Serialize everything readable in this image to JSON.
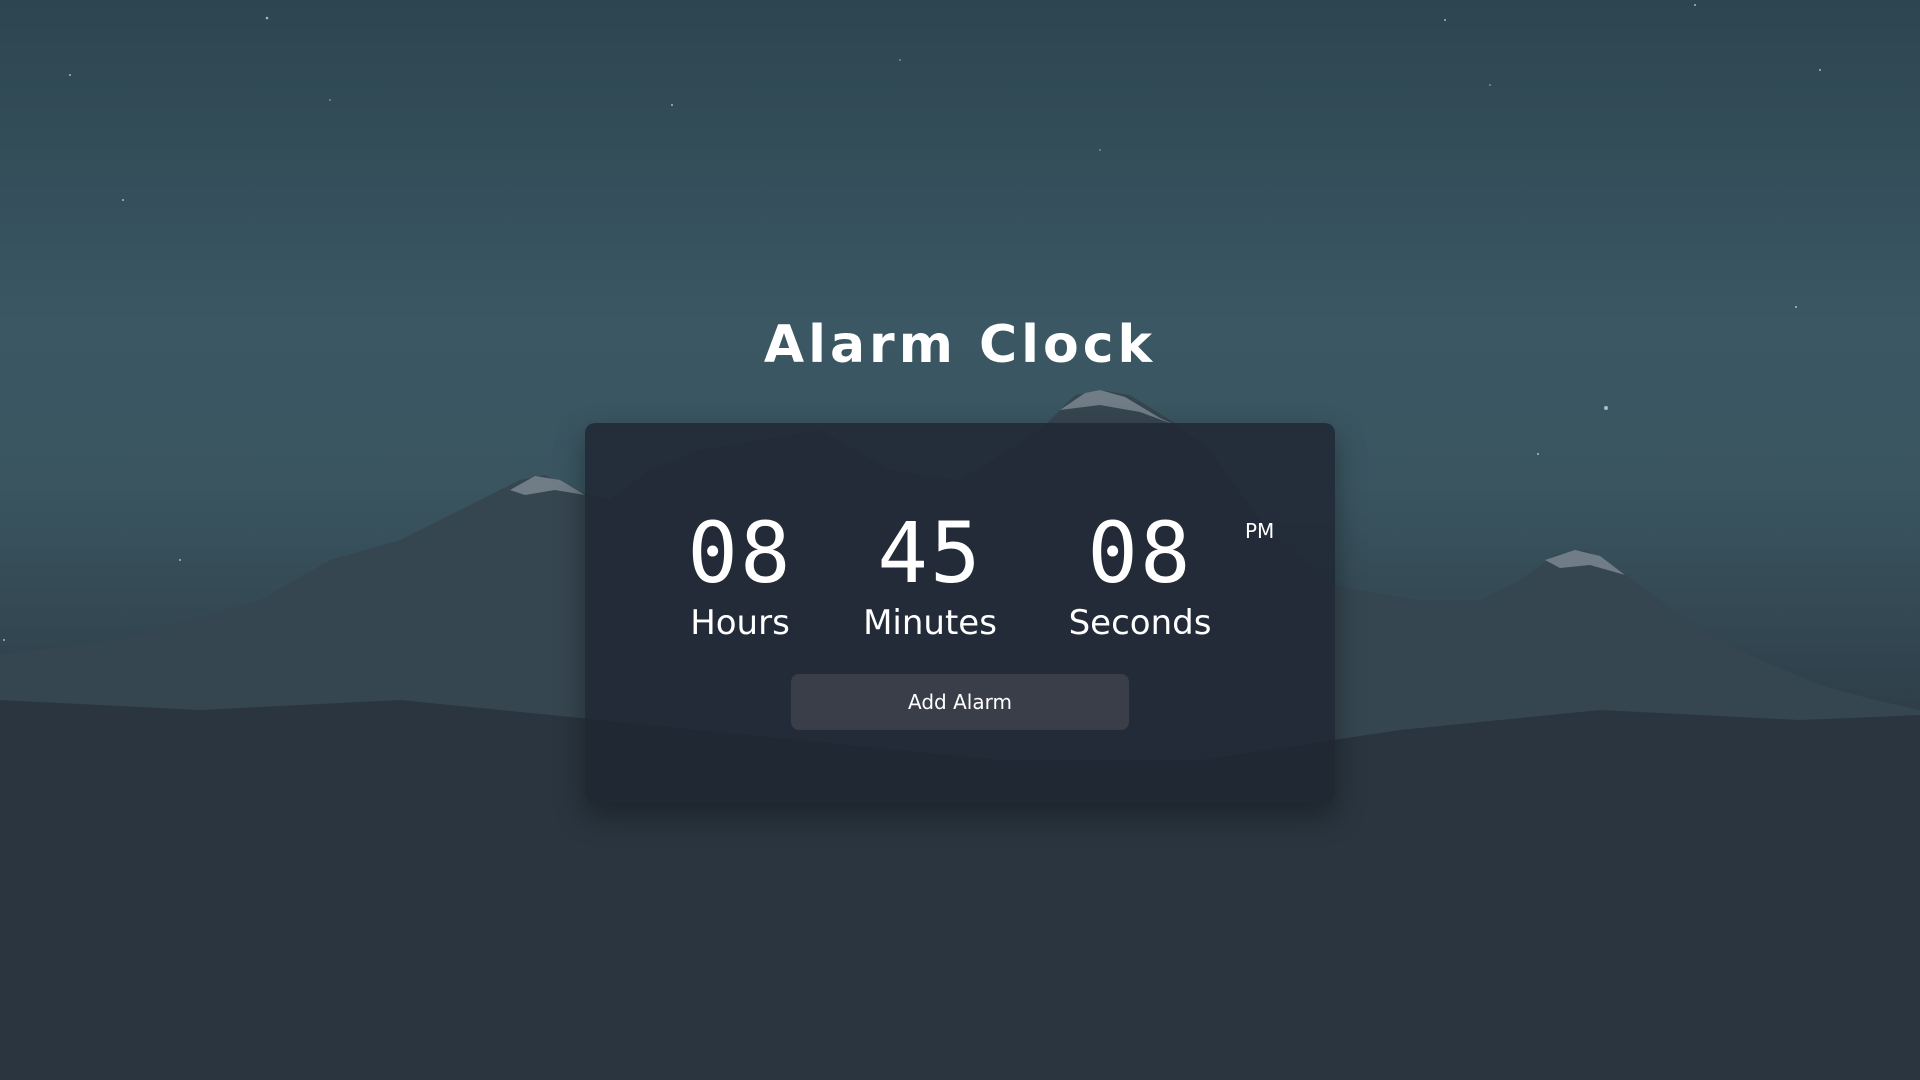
{
  "app": {
    "title": "Alarm Clock"
  },
  "clock": {
    "hours": "08",
    "minutes": "45",
    "seconds": "08",
    "period": "PM",
    "labels": {
      "hours": "Hours",
      "minutes": "Minutes",
      "seconds": "Seconds"
    }
  },
  "actions": {
    "add_alarm_label": "Add Alarm"
  },
  "colors": {
    "card_background": "#1f2632",
    "button_background": "#3a3e48",
    "text": "#ffffff",
    "sky_top": "#2d4550",
    "ground": "#1f2731"
  }
}
